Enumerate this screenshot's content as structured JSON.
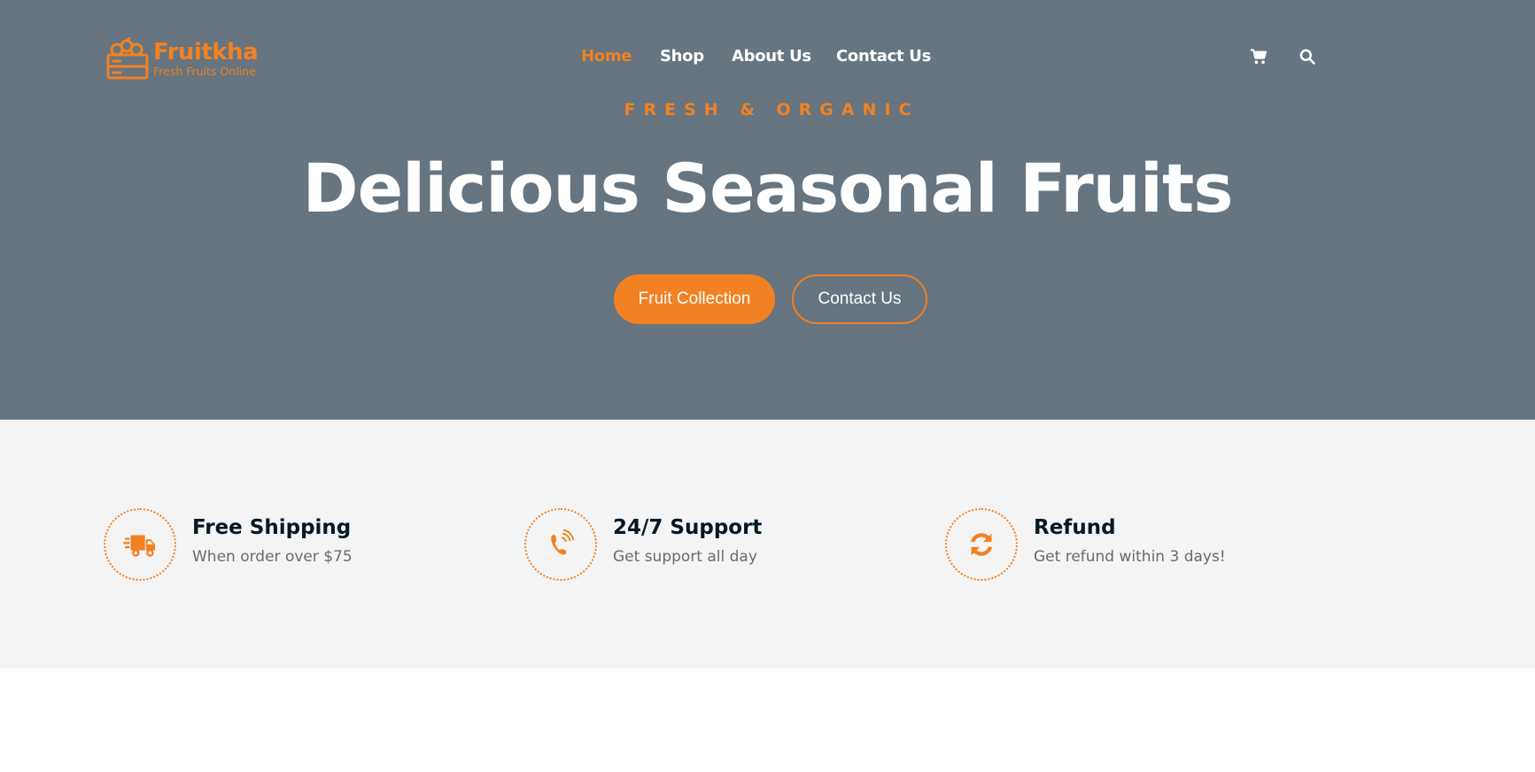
{
  "brand": {
    "name": "Fruitkha",
    "tagline": "Fresh Fruits Online",
    "accent_color": "#f28123",
    "hero_bg": "#66757f",
    "features_bg": "#f4f4f4"
  },
  "nav": {
    "items": [
      {
        "label": "Home",
        "active": true
      },
      {
        "label": "Shop",
        "active": false
      },
      {
        "label": "About Us",
        "active": false
      },
      {
        "label": "Contact Us",
        "active": false
      }
    ],
    "icons": [
      "cart-icon",
      "search-icon"
    ]
  },
  "hero": {
    "subtitle": "Fresh & Organic",
    "title": "Delicious Seasonal Fruits",
    "primary_button": "Fruit Collection",
    "secondary_button": "Contact Us"
  },
  "features": [
    {
      "icon": "truck-icon",
      "title": "Free Shipping",
      "desc": "When order over $75"
    },
    {
      "icon": "phone-icon",
      "title": "24/7 Support",
      "desc": "Get support all day"
    },
    {
      "icon": "refresh-icon",
      "title": "Refund",
      "desc": "Get refund within 3 days!"
    }
  ]
}
